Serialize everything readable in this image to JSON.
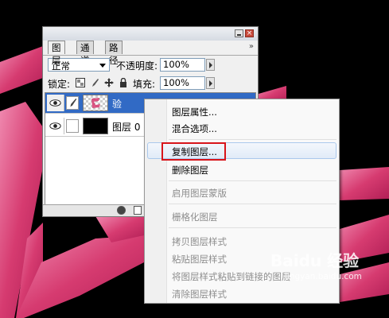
{
  "panel": {
    "tabs": [
      "图层",
      "通道",
      "路径"
    ],
    "collapse_glyph": "»",
    "close_glyph": "×",
    "blend_mode": "正常",
    "opacity_label": "不透明度:",
    "opacity_value": "100%",
    "lock_label": "锁定:",
    "fill_label": "填充:",
    "fill_value": "100%",
    "layers": [
      {
        "name": "验",
        "thumbnail": "checker-with-pink-glyph",
        "selected": true
      },
      {
        "name": "图层 0",
        "thumbnail": "black",
        "selected": false
      }
    ]
  },
  "context_menu": {
    "items": [
      {
        "label": "图层属性...",
        "enabled": true
      },
      {
        "label": "混合选项...",
        "enabled": true
      },
      {
        "label": "复制图层...",
        "enabled": true,
        "highlighted": true
      },
      {
        "label": "删除图层",
        "enabled": true
      },
      {
        "label": "启用图层蒙版",
        "enabled": false
      },
      {
        "label": "栅格化图层",
        "enabled": false
      },
      {
        "label": "拷贝图层样式",
        "enabled": false
      },
      {
        "label": "粘贴图层样式",
        "enabled": false
      },
      {
        "label": "将图层样式粘贴到链接的图层",
        "enabled": false
      },
      {
        "label": "清除图层样式",
        "enabled": false
      }
    ]
  },
  "watermark": {
    "text": "Baidu 经验",
    "url": "jingyan.baidu.com"
  },
  "colors": {
    "canvas": "#000000",
    "glyph_pink": "#d63b70",
    "selection_blue": "#316ac5",
    "highlight_red": "#d8141a"
  }
}
